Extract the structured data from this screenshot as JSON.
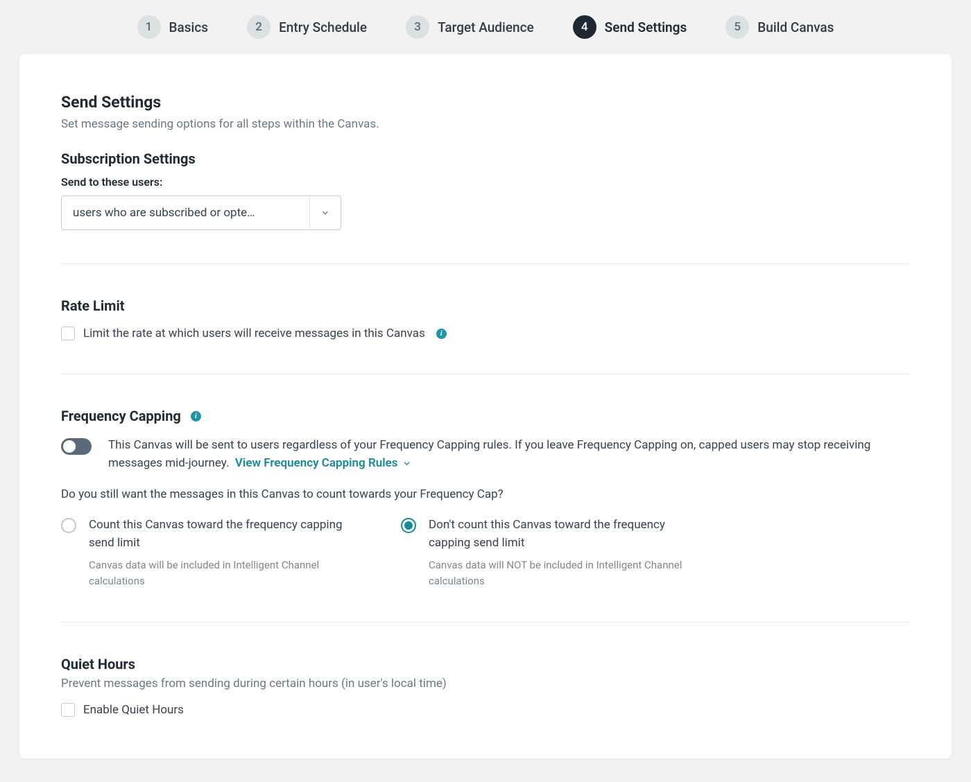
{
  "stepper": {
    "steps": [
      {
        "num": "1",
        "label": "Basics"
      },
      {
        "num": "2",
        "label": "Entry Schedule"
      },
      {
        "num": "3",
        "label": "Target Audience"
      },
      {
        "num": "4",
        "label": "Send Settings"
      },
      {
        "num": "5",
        "label": "Build Canvas"
      }
    ],
    "active_index": 3
  },
  "page": {
    "title": "Send Settings",
    "subtitle": "Set message sending options for all steps within the Canvas."
  },
  "subscription": {
    "heading": "Subscription Settings",
    "field_label": "Send to these users:",
    "selected": "users who are subscribed or opte…"
  },
  "rate_limit": {
    "heading": "Rate Limit",
    "checkbox_label": "Limit the rate at which users will receive messages in this Canvas"
  },
  "frequency": {
    "heading": "Frequency Capping",
    "toggle_text": "This Canvas will be sent to users regardless of your Frequency Capping rules. If you leave Frequency Capping on, capped users may stop receiving messages mid-journey.",
    "link_label": "View Frequency Capping Rules",
    "question": "Do you still want the messages in this Canvas to count towards your Frequency Cap?",
    "options": [
      {
        "title": "Count this Canvas toward the frequency capping send limit",
        "desc": "Canvas data will be included in Intelligent Channel calculations",
        "selected": false
      },
      {
        "title": "Don't count this Canvas toward the frequency capping send limit",
        "desc": "Canvas data will NOT be included in Intelligent Channel calculations",
        "selected": true
      }
    ]
  },
  "quiet_hours": {
    "heading": "Quiet Hours",
    "subtitle": "Prevent messages from sending during certain hours (in user's local time)",
    "checkbox_label": "Enable Quiet Hours"
  },
  "colors": {
    "accent": "#148a9c",
    "dark": "#1e2832"
  }
}
